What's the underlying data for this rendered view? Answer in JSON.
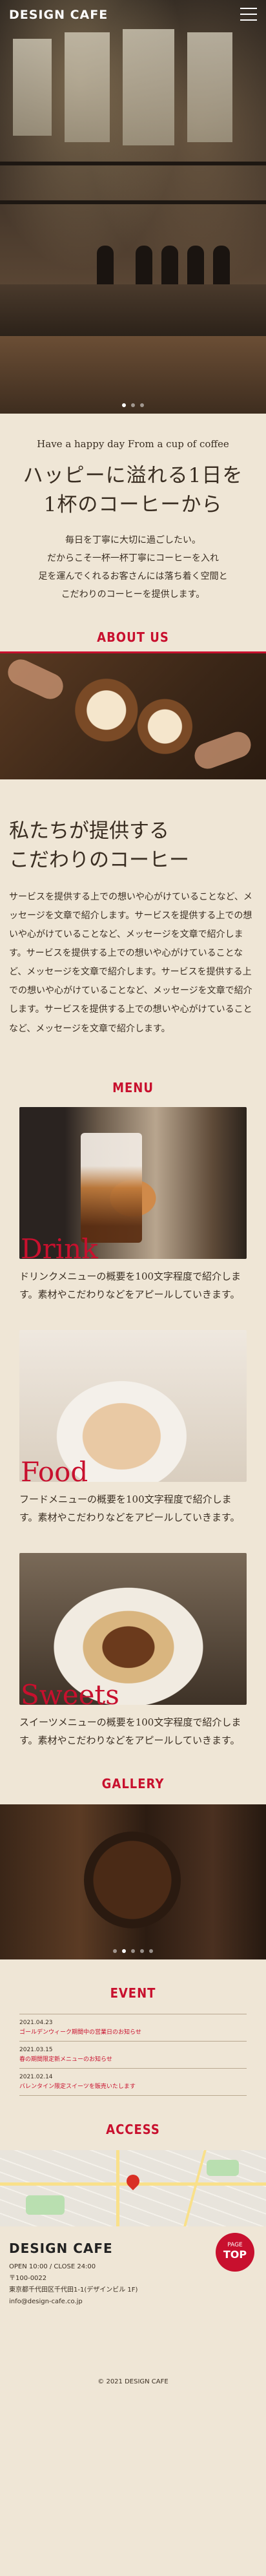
{
  "header": {
    "logo": "DESIGN CAFE"
  },
  "hero": {
    "slides": 3,
    "active": 0
  },
  "catch": {
    "sub": "Have a happy day From a cup of coffee",
    "title_line1": "ハッピーに溢れる1日を",
    "title_line2": "1杯のコーヒーから",
    "lines": [
      "毎日を丁寧に大切に過ごしたい。",
      "だからこそ一杯一杯丁寧にコーヒーを入れ",
      "足を運んでくれるお客さんには落ち着く空間と",
      "こだわりのコーヒーを提供します。"
    ]
  },
  "about": {
    "title": "ABOUT US",
    "heading_line1": "私たちが提供する",
    "heading_line2": "こだわりのコーヒー",
    "body": "サービスを提供する上での想いや心がけていることなど、メッセージを文章で紹介します。サービスを提供する上での想いや心がけていることなど、メッセージを文章で紹介します。サービスを提供する上での想いや心がけていることなど、メッセージを文章で紹介します。サービスを提供する上での想いや心がけていることなど、メッセージを文章で紹介します。サービスを提供する上での想いや心がけていることなど、メッセージを文章で紹介します。"
  },
  "menu": {
    "title": "MENU",
    "items": [
      {
        "name": "Drink",
        "desc": "ドリンクメニューの概要を100文字程度で紹介します。素材やこだわりなどをアピールしていきます。"
      },
      {
        "name": "Food",
        "desc": "フードメニューの概要を100文字程度で紹介します。素材やこだわりなどをアピールしていきます。"
      },
      {
        "name": "Sweets",
        "desc": "スイーツメニューの概要を100文字程度で紹介します。素材やこだわりなどをアピールしていきます。"
      }
    ]
  },
  "gallery": {
    "title": "GALLERY",
    "slides": 5,
    "active": 1
  },
  "event": {
    "title": "EVENT",
    "rows": [
      {
        "date": "2021.04.23",
        "text": "ゴールデンウィーク期間中の営業日のお知らせ"
      },
      {
        "date": "2021.03.15",
        "text": "春の期間限定新メニューのお知らせ"
      },
      {
        "date": "2021.02.14",
        "text": "バレンタイン限定スイーツを販売いたします"
      }
    ]
  },
  "access": {
    "title": "ACCESS"
  },
  "footer": {
    "logo": "DESIGN CAFE",
    "hours": "OPEN 10:00 / CLOSE 24:00",
    "zip": "〒100-0022",
    "address": "東京都千代田区千代田1-1(デザインビル 1F)",
    "mail": "info@design-cafe.co.jp",
    "pagetop_small": "PAGE",
    "pagetop_big": "TOP",
    "copyright": "© 2021 DESIGN CAFE"
  },
  "colors": {
    "accent": "#c8102e",
    "background": "#efe6d6",
    "text": "#3a2e22"
  }
}
